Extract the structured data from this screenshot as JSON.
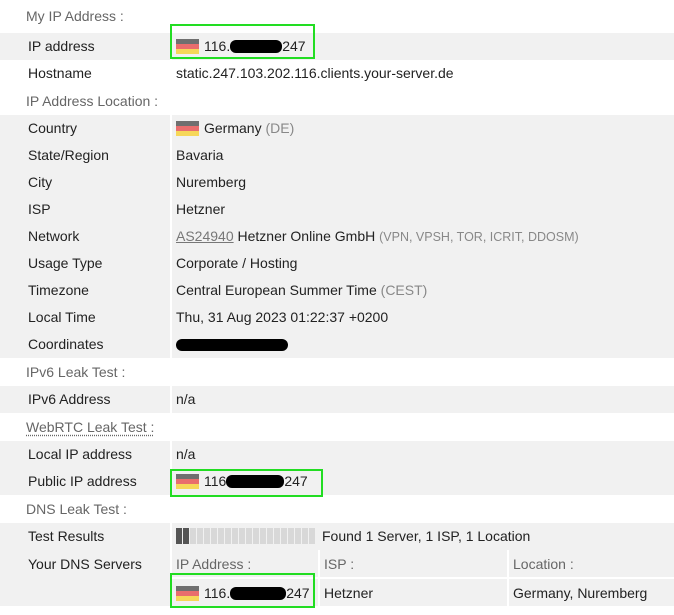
{
  "sections": {
    "my_ip": "My IP Address :",
    "location": "IP Address Location :",
    "ipv6": "IPv6 Leak Test :",
    "webrtc": "WebRTC Leak Test :",
    "dns": "DNS Leak Test :"
  },
  "my_ip": {
    "ip_label": "IP address",
    "ip_prefix": "116.",
    "ip_suffix": "247",
    "hostname_label": "Hostname",
    "hostname": "static.247.103.202.116.clients.your-server.de"
  },
  "location": {
    "country_label": "Country",
    "country": "Germany",
    "country_code": "(DE)",
    "state_label": "State/Region",
    "state": "Bavaria",
    "city_label": "City",
    "city": "Nuremberg",
    "isp_label": "ISP",
    "isp": "Hetzner",
    "network_label": "Network",
    "asn": "AS24940",
    "network_name": "Hetzner Online GmbH",
    "network_flags": "(VPN, VPSH, TOR, ICRIT, DDOSM)",
    "usage_label": "Usage Type",
    "usage": "Corporate / Hosting",
    "timezone_label": "Timezone",
    "timezone": "Central European Summer Time",
    "timezone_abbr": "(CEST)",
    "localtime_label": "Local Time",
    "localtime": "Thu, 31 Aug 2023 01:22:37 +0200",
    "coords_label": "Coordinates"
  },
  "ipv6": {
    "label": "IPv6 Address",
    "value": "n/a"
  },
  "webrtc": {
    "local_label": "Local IP address",
    "local_value": "n/a",
    "public_label": "Public IP address",
    "public_prefix": "116",
    "public_suffix": "247"
  },
  "dns": {
    "results_label": "Test Results",
    "results_text": "Found 1 Server, 1 ISP, 1 Location",
    "progress_filled": 2,
    "progress_total": 20,
    "servers_label": "Your DNS Servers",
    "col_ip": "IP Address :",
    "col_isp": "ISP :",
    "col_location": "Location :",
    "server_ip_prefix": "116.",
    "server_ip_suffix": "247",
    "server_isp": "Hetzner",
    "server_location": "Germany, Nuremberg"
  },
  "colors": {
    "highlight": "#22dd22",
    "row_shade": "#f1f1f1",
    "muted": "#888888"
  },
  "icons": [
    "germany-flag-icon",
    "redaction-bar"
  ]
}
